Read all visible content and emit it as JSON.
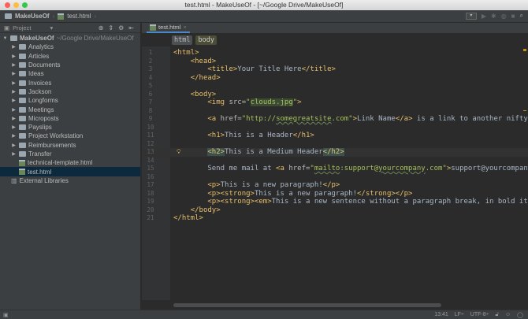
{
  "window": {
    "title": "test.html - MakeUseOf - [~/Google Drive/MakeUseOf]"
  },
  "navbar": {
    "project": "MakeUseOf",
    "file": "test.html"
  },
  "sidebar": {
    "view_label": "Project",
    "root": "MakeUseOf",
    "root_path": "~/Google Drive/MakeUseOf",
    "folders": [
      "Analytics",
      "Articles",
      "Documents",
      "Ideas",
      "Invoices",
      "Jackson",
      "Longforms",
      "Meetings",
      "Microposts",
      "Payslips",
      "Project Workstation",
      "Reimbursements",
      "Transfer"
    ],
    "files": [
      "technical-template.html",
      "test.html"
    ],
    "external": "External Libraries"
  },
  "editor": {
    "tab": "test.html",
    "breadcrumbs": [
      "html",
      "body"
    ],
    "lines": [
      [
        [
          "tag",
          "<html>"
        ]
      ],
      [
        [
          "t",
          "    "
        ],
        [
          "tag",
          "<head>"
        ]
      ],
      [
        [
          "t",
          "        "
        ],
        [
          "tag",
          "<title>"
        ],
        [
          "t",
          "Your Title Here"
        ],
        [
          "tag",
          "</title>"
        ]
      ],
      [
        [
          "t",
          "    "
        ],
        [
          "tag",
          "</head>"
        ]
      ],
      [],
      [
        [
          "t",
          "    "
        ],
        [
          "tag",
          "<body>"
        ]
      ],
      [
        [
          "t",
          "        "
        ],
        [
          "tag",
          "<img "
        ],
        [
          "attr",
          "src="
        ],
        [
          "str",
          "\""
        ],
        [
          "strh",
          "clouds.jpg"
        ],
        [
          "str",
          "\""
        ],
        [
          "tag",
          ">"
        ]
      ],
      [],
      [
        [
          "t",
          "        "
        ],
        [
          "tag",
          "<a "
        ],
        [
          "attr",
          "href="
        ],
        [
          "str",
          "\"http://"
        ],
        [
          "stru",
          "somegreatsite"
        ],
        [
          "str",
          ".com\""
        ],
        [
          "tag",
          ">"
        ],
        [
          "t",
          "Link Name"
        ],
        [
          "tag",
          "</a>"
        ],
        [
          "t",
          " is a link to another nifty"
        ]
      ],
      [],
      [
        [
          "t",
          "        "
        ],
        [
          "tag",
          "<h1>"
        ],
        [
          "t",
          "This is a Header"
        ],
        [
          "tag",
          "</h1>"
        ]
      ],
      [],
      [
        [
          "t",
          "        "
        ],
        [
          "tagm",
          "<h2>"
        ],
        [
          "t",
          "This is a Medium Header"
        ],
        [
          "tagm",
          "</h2>"
        ]
      ],
      [],
      [
        [
          "t",
          "        Send me mail at "
        ],
        [
          "tag",
          "<a "
        ],
        [
          "attr",
          "href="
        ],
        [
          "str",
          "\""
        ],
        [
          "stru",
          "mailto"
        ],
        [
          "str",
          ":support@"
        ],
        [
          "stru",
          "yourcompany"
        ],
        [
          "str",
          ".com\""
        ],
        [
          "tag",
          ">"
        ],
        [
          "t",
          "support@yourcompany"
        ]
      ],
      [],
      [
        [
          "t",
          "        "
        ],
        [
          "tag",
          "<p>"
        ],
        [
          "t",
          "This is a new paragraph!"
        ],
        [
          "tag",
          "</p>"
        ]
      ],
      [
        [
          "t",
          "        "
        ],
        [
          "tag",
          "<p><strong>"
        ],
        [
          "t",
          "This is a new paragraph!"
        ],
        [
          "tag",
          "</strong></p>"
        ]
      ],
      [
        [
          "t",
          "        "
        ],
        [
          "tag",
          "<p><strong><em>"
        ],
        [
          "t",
          "This is a new sentence without a paragraph break, in bold ita"
        ]
      ],
      [
        [
          "t",
          "    "
        ],
        [
          "tag",
          "</body>"
        ]
      ],
      [
        [
          "tag",
          "</html>"
        ]
      ]
    ]
  },
  "status": {
    "position": "13:41",
    "line_sep": "LF÷",
    "encoding": "UTF-8÷"
  }
}
